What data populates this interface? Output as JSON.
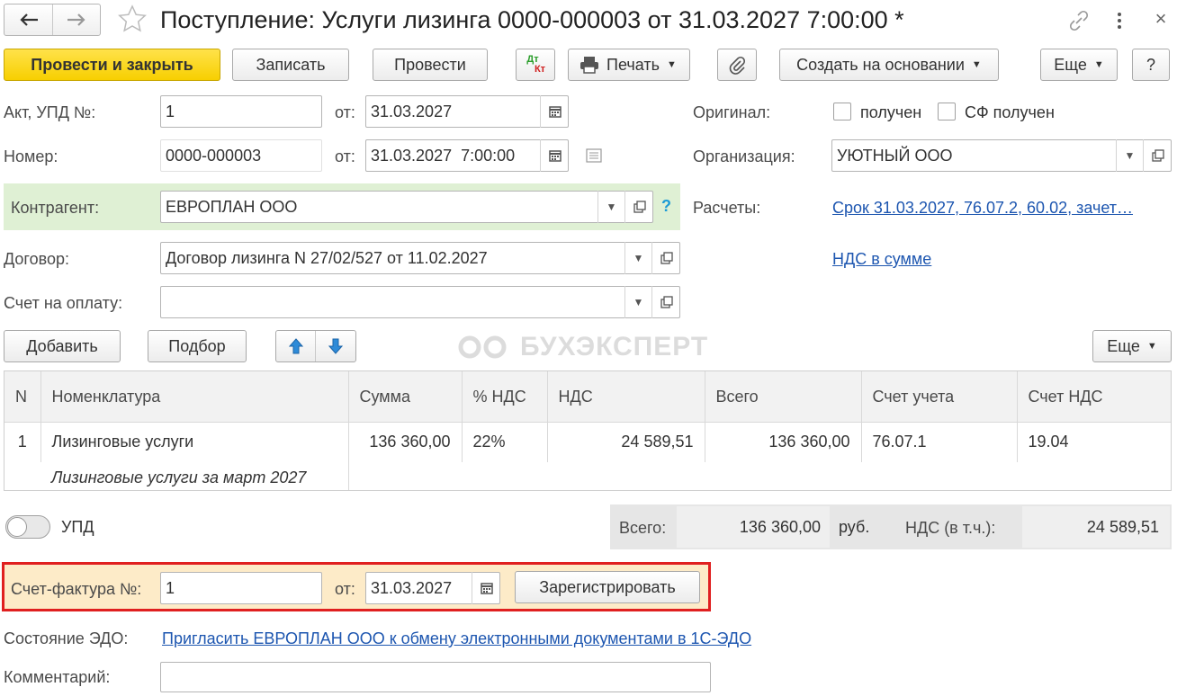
{
  "window": {
    "title": "Поступление: Услуги лизинга 0000-000003 от 31.03.2027 7:00:00 *",
    "close_glyph": "×"
  },
  "toolbar": {
    "post_close": "Провести и закрыть",
    "save": "Записать",
    "post": "Провести",
    "dtkt_top": "Дт",
    "dtkt_bottom": "Кт",
    "print": "Печать",
    "create_based": "Создать на основании",
    "more": "Еще",
    "help": "?"
  },
  "header": {
    "act_label": "Акт, УПД №:",
    "act_value": "1",
    "from_label": "от:",
    "act_date": "31.03.2027",
    "number_label": "Номер:",
    "number_value": "0000-000003",
    "number_date": "31.03.2027  7:00:00",
    "original_label": "Оригинал:",
    "received_label": "получен",
    "sf_received_label": "СФ получен",
    "org_label": "Организация:",
    "org_value": "УЮТНЫЙ ООО",
    "counterparty_label": "Контрагент:",
    "counterparty_value": "ЕВРОПЛАН ООО",
    "counterparty_help": "?",
    "settlements_label": "Расчеты:",
    "settlements_link": "Срок 31.03.2027, 76.07.2, 60.02, зачет…",
    "contract_label": "Договор:",
    "contract_value": "Договор лизинга N 27/02/527 от 11.02.2027",
    "vat_link": "НДС в сумме",
    "invoice_label": "Счет на оплату:",
    "invoice_value": ""
  },
  "table_toolbar": {
    "add": "Добавить",
    "select": "Подбор",
    "more": "Еще",
    "watermark": "БУХЭКСПЕРТ"
  },
  "table": {
    "columns": [
      "N",
      "Номенклатура",
      "Сумма",
      "% НДС",
      "НДС",
      "Всего",
      "Счет учета",
      "Счет НДС"
    ],
    "rows": [
      {
        "n": "1",
        "item": "Лизинговые услуги",
        "content": "Лизинговые услуги за март 2027",
        "sum": "136 360,00",
        "vat_rate": "22%",
        "vat": "24 589,51",
        "total": "136 360,00",
        "account": "76.07.1",
        "vat_account": "19.04"
      }
    ]
  },
  "totals": {
    "upd_label": "УПД",
    "total_label": "Всего:",
    "total_value": "136 360,00",
    "currency": "руб.",
    "vat_label": "НДС (в т.ч.):",
    "vat_value": "24 589,51"
  },
  "invoice": {
    "label": "Счет-фактура №:",
    "number": "1",
    "from_label": "от:",
    "date": "31.03.2027",
    "register": "Зарегистрировать"
  },
  "footer": {
    "edo_label": "Состояние ЭДО:",
    "edo_link": "Пригласить ЕВРОПЛАН ООО к обмену электронными документами в 1С-ЭДО",
    "comment_label": "Комментарий:",
    "comment_value": ""
  },
  "colors": {
    "primary_button": "#f7cf00",
    "counterparty_bg": "#dff0d4",
    "link": "#1d56b0",
    "highlight_border": "#e02020",
    "invoice_bg": "#fdebc8",
    "totals_bg": "#e6e6e6"
  }
}
